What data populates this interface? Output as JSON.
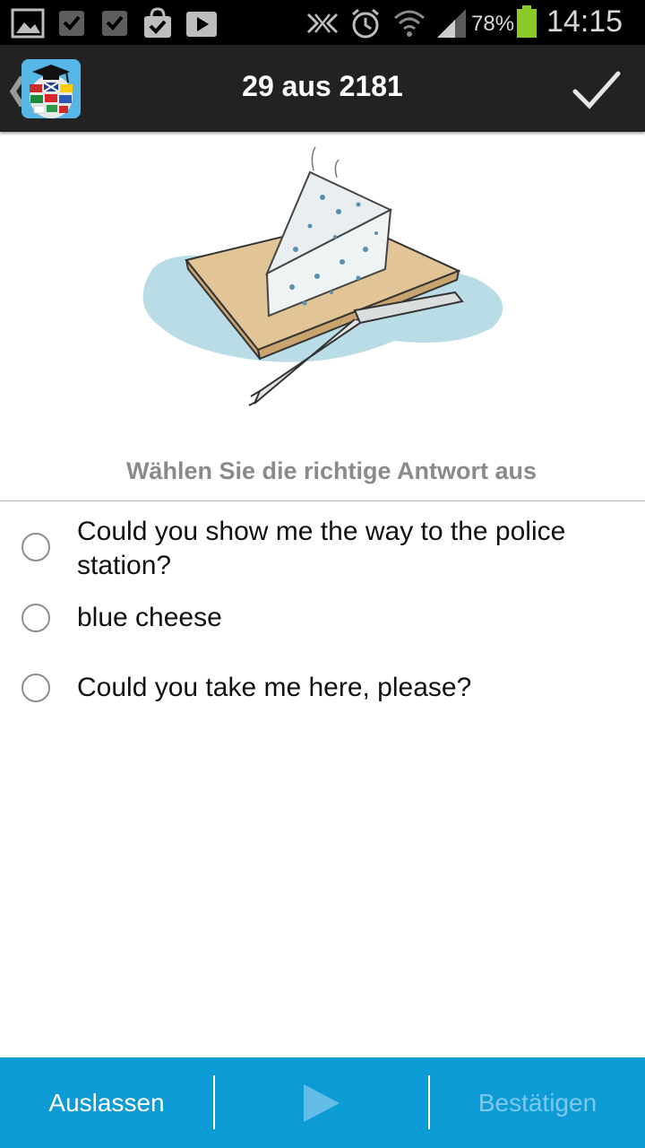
{
  "status_bar": {
    "battery_percent": "78%",
    "time": "14:15",
    "icons": [
      "gallery-icon",
      "task-check-icon",
      "task-check-icon",
      "shopping-bag-icon",
      "play-store-icon",
      "nfc-icon",
      "alarm-icon",
      "wifi-icon",
      "signal-icon",
      "battery-icon"
    ],
    "battery_color": "#8ac926"
  },
  "action_bar": {
    "progress_title": "29 aus 2181",
    "icons": [
      "back-caret-icon",
      "app-logo-icon",
      "checkmark-icon"
    ]
  },
  "question": {
    "illustration": "blue-cheese-on-board-illustration",
    "instruction": "Wählen Sie die richtige Antwort aus",
    "options": [
      {
        "label": "Could you show me the way to the police station?",
        "selected": false
      },
      {
        "label": "blue cheese",
        "selected": false
      },
      {
        "label": "Could you take me here, please?",
        "selected": false
      }
    ]
  },
  "bottom_bar": {
    "skip_label": "Auslassen",
    "next_icon": "play-arrow-icon",
    "confirm_label": "Bestätigen",
    "accent_color": "#0d9bd6"
  }
}
